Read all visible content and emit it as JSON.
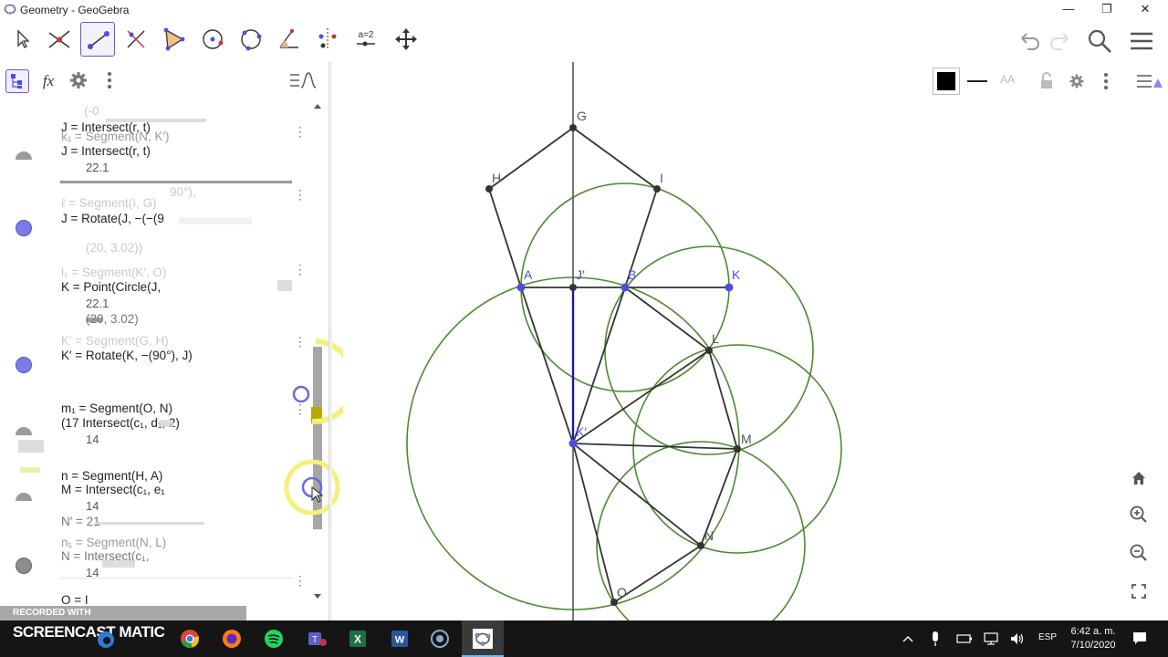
{
  "window": {
    "title": "Geometry - GeoGebra",
    "minimize": "—",
    "restore": "❐",
    "close": "✕"
  },
  "toolbar": {
    "tools": [
      "move-tool",
      "point-tool",
      "segment-tool",
      "perpendicular-tool",
      "polygon-tool",
      "circle-tool",
      "circle-three-points-tool",
      "angle-tool",
      "reflect-tool",
      "slider-tool",
      "move-graphics-tool"
    ],
    "slider_label": "a=2",
    "right": [
      "undo",
      "redo",
      "search",
      "menu"
    ]
  },
  "algebra_header": {
    "fx_label": "fx"
  },
  "algebra": {
    "rows": [
      {
        "label": "J  =  Intersect(r, t)",
        "ghost": "(-0"
      },
      {
        "label": "k₁  =  Segment(N, K′)"
      },
      {
        "label": "J  =  Intersect(r, t)",
        "value": "22.1"
      },
      {
        "label": "ℓ  =  Segment(I, G)",
        "ghost": "90°),"
      },
      {
        "label": "J  =  Rotate(J, −(−(9",
        "ghost": "(20,  3.02))"
      },
      {
        "label": "l₁  =  Segment(K′, O)"
      },
      {
        "label": "K  =  Point(Circle(J,",
        "value": "22.1"
      },
      {
        "label": "(20,  3.02)"
      },
      {
        "label": "K′  =  Segment(G, H)"
      },
      {
        "label": "K′  =  Rotate(K, −(90°), J)"
      },
      {
        "label": "m₁  =  Segment(O, N)"
      },
      {
        "label": "(17  Intersect(c₁, d₁, 2)",
        "value": "14"
      },
      {
        "label": "n  =  Segment(H, A)"
      },
      {
        "label": "M  =  Intersect(c₁, e₁",
        "value": "14"
      },
      {
        "label": "N′  =  21"
      },
      {
        "label": "n₁  =  Segment(N, L)"
      },
      {
        "label": "N  =  Intersect(c₁,",
        "value": "14"
      },
      {
        "label": "O  =  I"
      }
    ]
  },
  "style_bar": {
    "font_size": "AA"
  },
  "graphics": {
    "points": [
      "G",
      "H",
      "I",
      "A",
      "J′",
      "B",
      "K",
      "L",
      "K′",
      "M",
      "N",
      "O"
    ],
    "colors": {
      "circle": "#4c8a30",
      "segment": "#333333",
      "axis": "#555555",
      "blue": "#1a1aa0",
      "point_blue": "#4d4de0"
    }
  },
  "overlay": {
    "recorded_with": "RECORDED WITH",
    "screencast_logo": "SCREENCAST  MATIC"
  },
  "taskbar": {
    "lang": "ESP",
    "time": "6:42 a. m.",
    "date": "7/10/2020"
  }
}
